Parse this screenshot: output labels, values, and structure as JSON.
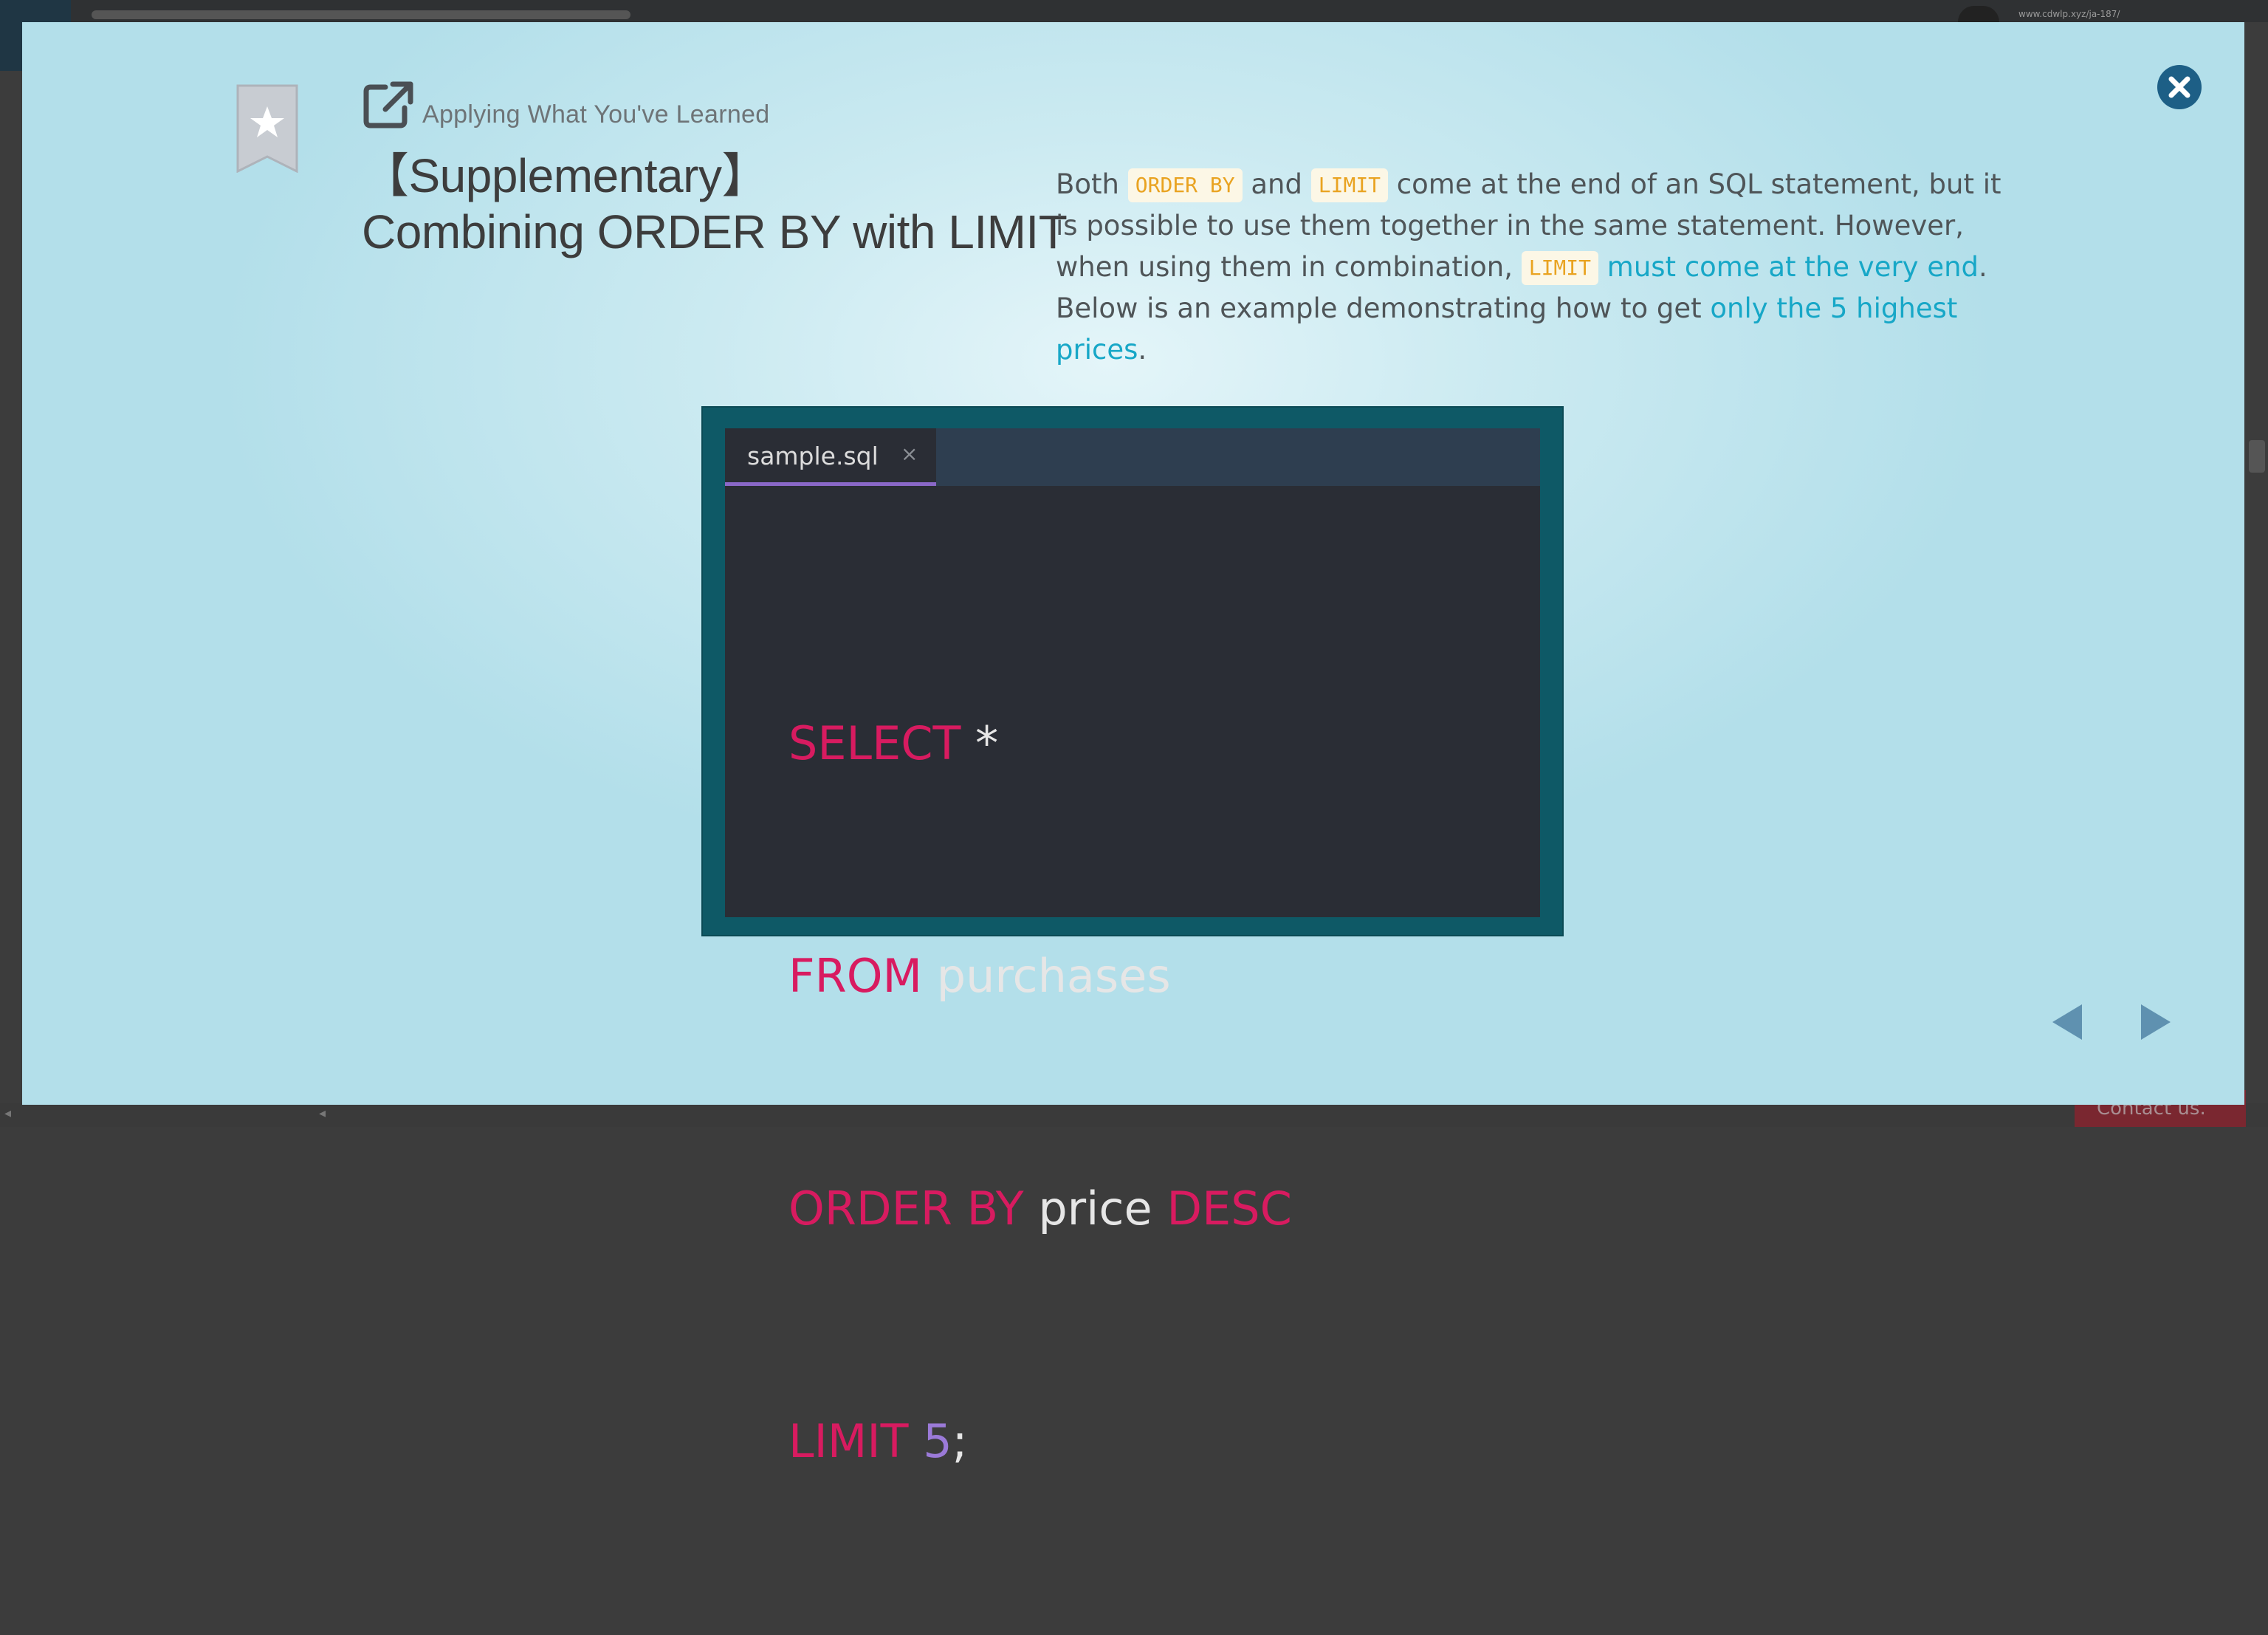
{
  "background": {
    "url_text": "www.cdwlp.xyz/ja-187/",
    "contact_label": "Contact us."
  },
  "modal": {
    "section_label": "Applying What You've Learned",
    "title_line1": "【Supplementary】",
    "title_line2": "Combining ORDER BY with LIMIT",
    "description": {
      "t1": "Both ",
      "c1": "ORDER BY",
      "t2": " and ",
      "c2": "LIMIT",
      "t3": " come at the end of an SQL statement, but it is possible to use them together in the same statement. However, when using them in combination, ",
      "c3": "LIMIT",
      "t4": " ",
      "h1": "must come at the very end",
      "t5": ". Below is an example demonstrating how to get ",
      "h2": "only the 5 highest prices",
      "t6": "."
    },
    "editor": {
      "tab_name": "sample.sql",
      "tab_close": "×",
      "lines": {
        "l1_kw": "SELECT",
        "l1_rest": "*",
        "l2_kw": "FROM",
        "l2_rest": "purchases",
        "l3_kw1": "ORDER",
        "l3_kw2": "BY",
        "l3_rest": "price",
        "l3_kw3": "DESC",
        "l4_kw": "LIMIT",
        "l4_num": "5",
        "l4_end": ";"
      }
    },
    "icons": {
      "bookmark": "bookmark-star-icon",
      "external": "external-link-icon",
      "close": "close-circle-icon",
      "prev": "triangle-left-icon",
      "next": "triangle-right-icon"
    },
    "colors": {
      "keyword": "#d81b60",
      "highlight": "#17a7c7",
      "inline_code": "#e9a321",
      "tab_underline": "#8a68c8",
      "editor_frame": "#0e5966"
    }
  }
}
